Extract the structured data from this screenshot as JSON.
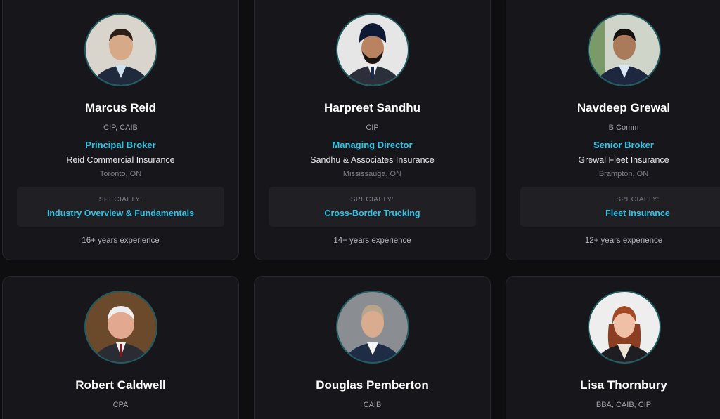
{
  "colors": {
    "background": "#0e0e11",
    "card": "#17171b",
    "accent": "#2ec4e6",
    "avatar_border": "#1f5e63"
  },
  "labels": {
    "specialty": "SPECIALTY:"
  },
  "members": [
    {
      "name": "Marcus Reid",
      "credentials": "CIP, CAIB",
      "title": "Principal Broker",
      "company": "Reid Commercial Insurance",
      "location": "Toronto, ON",
      "specialty": "Industry Overview & Fundamentals",
      "experience": "16+ years experience",
      "photo": "headshot-photo"
    },
    {
      "name": "Harpreet Sandhu",
      "credentials": "CIP",
      "title": "Managing Director",
      "company": "Sandhu & Associates Insurance",
      "location": "Mississauga, ON",
      "specialty": "Cross-Border Trucking",
      "experience": "14+ years experience",
      "photo": "headshot-photo"
    },
    {
      "name": "Navdeep Grewal",
      "credentials": "B.Comm",
      "title": "Senior Broker",
      "company": "Grewal Fleet Insurance",
      "location": "Brampton, ON",
      "specialty": "Fleet Insurance",
      "experience": "12+ years experience",
      "photo": "headshot-photo"
    },
    {
      "name": "Robert Caldwell",
      "credentials": "CPA",
      "photo": "headshot-photo"
    },
    {
      "name": "Douglas Pemberton",
      "credentials": "CAIB",
      "photo": "headshot-photo"
    },
    {
      "name": "Lisa Thornbury",
      "credentials": "BBA, CAIB, CIP",
      "photo": "headshot-photo"
    }
  ]
}
